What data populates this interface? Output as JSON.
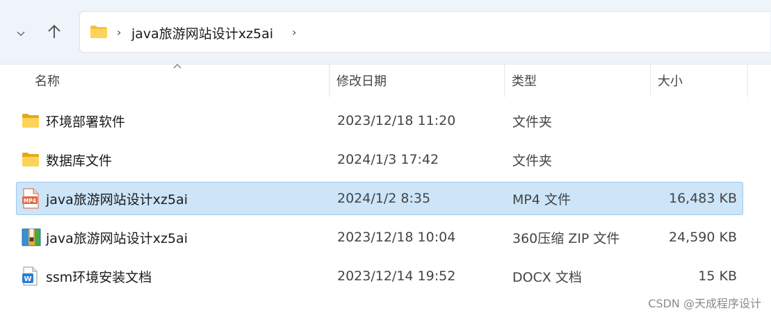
{
  "address_bar": {
    "path": "java旅游网站设计xz5ai"
  },
  "columns": {
    "name": "名称",
    "date_modified": "修改日期",
    "type": "类型",
    "size": "大小"
  },
  "files": [
    {
      "name": "环境部署软件",
      "date": "2023/12/18 11:20",
      "type": "文件夹",
      "size": "",
      "icon": "folder-icon",
      "selected": false
    },
    {
      "name": "数据库文件",
      "date": "2024/1/3 17:42",
      "type": "文件夹",
      "size": "",
      "icon": "folder-icon",
      "selected": false
    },
    {
      "name": "java旅游网站设计xz5ai",
      "date": "2024/1/2 8:35",
      "type": "MP4 文件",
      "size": "16,483 KB",
      "icon": "mp4-file-icon",
      "selected": true
    },
    {
      "name": "java旅游网站设计xz5ai",
      "date": "2023/12/18 10:04",
      "type": "360压缩 ZIP 文件",
      "size": "24,590 KB",
      "icon": "zip-archive-icon",
      "selected": false
    },
    {
      "name": "ssm环境安装文档",
      "date": "2023/12/14 19:52",
      "type": "DOCX 文档",
      "size": "15 KB",
      "icon": "word-document-icon",
      "selected": false
    }
  ],
  "watermark": "CSDN @天成程序设计",
  "colors": {
    "selection_bg": "#cce5f8",
    "selection_border": "#99c9ef",
    "folder": "#f5c23a",
    "toolbar_bg": "#eef4f9"
  }
}
